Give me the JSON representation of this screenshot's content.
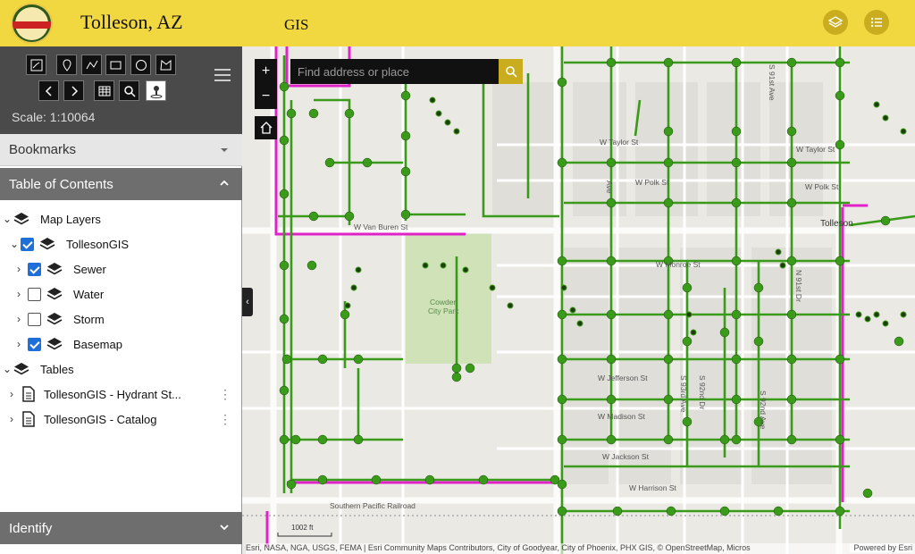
{
  "header": {
    "title": "Tolleson, AZ",
    "subtitle": "GIS",
    "logo_text": "TOLLESON",
    "accent_color": "#f2d840"
  },
  "toolbar": {
    "tools_row1": [
      "freehand-icon",
      "pin-icon",
      "polyline-icon",
      "rectangle-icon",
      "circle-icon",
      "polygon-icon"
    ],
    "tools_row2": [
      "back-icon",
      "forward-icon",
      "table-icon",
      "search-icon",
      "locate-icon"
    ],
    "scale_label": "Scale: 1:10064"
  },
  "panels": {
    "bookmarks": "Bookmarks",
    "toc": "Table of Contents",
    "identify": "Identify"
  },
  "toc": {
    "map_layers": "Map Layers",
    "group": "TollesonGIS",
    "layers": [
      {
        "label": "Sewer",
        "checked": true
      },
      {
        "label": "Water",
        "checked": false
      },
      {
        "label": "Storm",
        "checked": false
      },
      {
        "label": "Basemap",
        "checked": true
      }
    ],
    "tables_label": "Tables",
    "tables": [
      "TollesonGIS - Hydrant St...",
      "TollesonGIS - Catalog"
    ]
  },
  "map": {
    "search_placeholder": "Find address or place",
    "zoom_in": "+",
    "zoom_out": "−",
    "scale_bar": "1002 ft",
    "labels": {
      "taylor_west": "W Taylor St",
      "taylor_east": "W Taylor St",
      "polk_west": "W Polk St",
      "polk_east": "W Polk St",
      "van_buren": "W Van Buren St",
      "monroe": "W Monroe St",
      "jefferson": "W Jefferson St",
      "madison": "W Madison St",
      "jackson": "W Jackson St",
      "harrison": "W Harrison St",
      "railroad": "Southern Pacific Railroad",
      "park_1": "Cowden",
      "park_2": "City Park",
      "tolleson": "Tolleson",
      "ave_1": "S 93rd Ave",
      "dr_1": "S 92nd Dr",
      "ave_2": "S 92nd Ave",
      "dr_2": "N 91st Dr",
      "ave_3": "S 91st Ave",
      "ave_4": "Ave"
    },
    "attribution": "Esri, NASA, NGA, USGS, FEMA | Esri Community Maps Contributors, City of Goodyear, City of Phoenix, PHX GIS, © OpenStreetMap, Micros",
    "powered_by": "Powered by Esri",
    "pipe_color": "#3a9a1a",
    "boundary_color": "#e023c8"
  }
}
